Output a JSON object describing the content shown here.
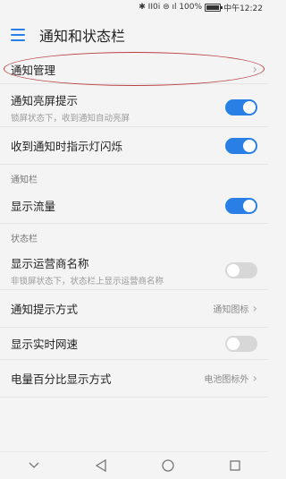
{
  "status_bar": {
    "text": "✱ ⅠⅠ0ⅰ ⊜ ıl 100%",
    "time": "中午12:22",
    "battery_level": 1.0
  },
  "app_bar": {
    "title": "通知和状态栏"
  },
  "notification_management": {
    "label": "通知管理"
  },
  "rows": {
    "lockscreen_wake": {
      "label": "通知亮屏提示",
      "sub": "锁屏状态下，收到通知自动亮屏",
      "on": true
    },
    "indicator_light": {
      "label": "收到通知时指示灯闪烁",
      "on": true
    }
  },
  "section_notification_bar": "通知栏",
  "show_traffic": {
    "label": "显示流量",
    "on": true
  },
  "section_status_bar": "状态栏",
  "carrier_name": {
    "label": "显示运营商名称",
    "sub": "非锁屏状态下，状态栏上显示运营商名称",
    "on": false
  },
  "notification_style": {
    "label": "通知提示方式",
    "value": "通知图标"
  },
  "realtime_speed": {
    "label": "显示实时网速",
    "on": false
  },
  "battery_percent": {
    "label": "电量百分比显示方式",
    "value": "电池图标外"
  },
  "colors": {
    "accent": "#2a7fe6",
    "toggle_off": "#d7d7d7",
    "annotation": "#b84040"
  },
  "icons": [
    "bluetooth-icon",
    "wifi-icon",
    "signal-icon",
    "battery-icon",
    "menu-icon",
    "chevron-right-icon",
    "nav-down-icon",
    "nav-back-icon",
    "nav-home-icon",
    "nav-recents-icon"
  ]
}
